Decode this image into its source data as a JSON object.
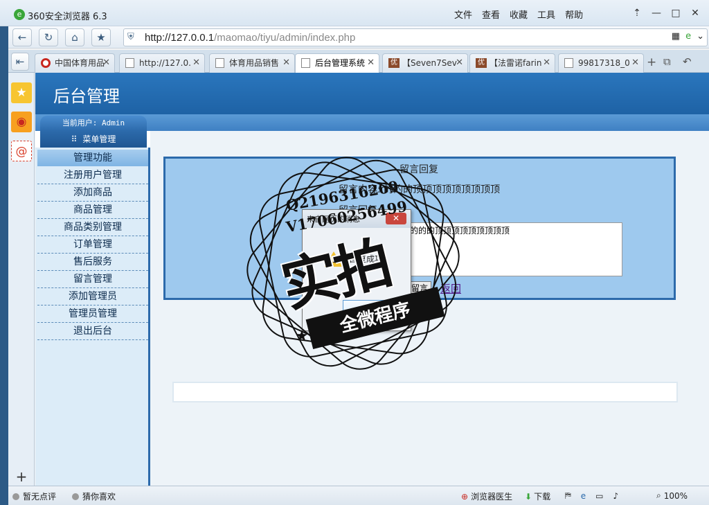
{
  "window": {
    "title": "360安全浏览器 6.3",
    "menus": [
      "文件",
      "查看",
      "收藏",
      "工具",
      "帮助"
    ]
  },
  "address_bar": {
    "url_host": "http://127.0.0.1",
    "url_path": "/maomao/tiyu/admin/index.php"
  },
  "tabs": [
    {
      "label": "中国体育用品",
      "icon": "red"
    },
    {
      "label": "http://127.0.",
      "icon": "page"
    },
    {
      "label": "体育用品销售",
      "icon": "page"
    },
    {
      "label": "后台管理系统",
      "icon": "page",
      "active": true
    },
    {
      "label": "【Seven7Sev",
      "icon": "brand"
    },
    {
      "label": "【法雷诺farin",
      "icon": "brand"
    },
    {
      "label": "99817318_0",
      "icon": "page"
    }
  ],
  "header": {
    "title": "后台管理"
  },
  "menu_head": {
    "current_user": "当前用户: Admin",
    "menu_label": "菜单管理"
  },
  "left_menu": {
    "heading": "管理功能",
    "items": [
      "注册用户管理",
      "添加商品",
      "商品管理",
      "商品类别管理",
      "订单管理",
      "售后服务",
      "留言管理",
      "添加管理员",
      "管理员管理",
      "退出后台"
    ]
  },
  "reply": {
    "title": "留言回复",
    "content": "留言内容: 的的的顶顶顶顶顶顶顶顶顶",
    "reply_label": "留言回复:",
    "textarea_value": "的的的顶顶顶顶顶顶顶顶顶",
    "submit_label": "留言",
    "back_label": "返回"
  },
  "alert": {
    "title": "来自网页的消息",
    "message": "回复成功"
  },
  "watermark": {
    "qq": "Q2196316269",
    "vx": "V17060256499",
    "main": "实拍",
    "band": "全微程序"
  },
  "statusbar": {
    "rating": "暂无点评",
    "guess": "猜你喜欢",
    "doctor": "浏览器医生",
    "download": "下载",
    "zoom": "100%"
  },
  "colors": {
    "header_blue": "#1e62a5",
    "menu_bg": "#dcecf8",
    "reply_bg": "#9ec9ee"
  }
}
